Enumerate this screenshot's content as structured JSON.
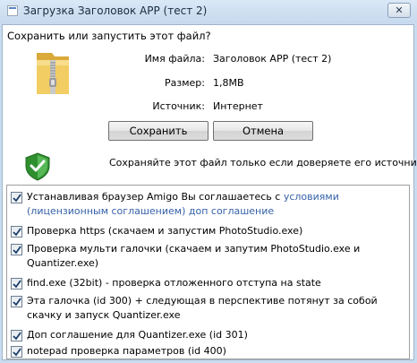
{
  "window": {
    "title": "Загрузка Заголовок APP (тест 2)",
    "close_glyph": "✕"
  },
  "dialog": {
    "question": "Сохранить или запустить этот файл?",
    "file_name_label": "Имя файла:",
    "file_name_value": "Заголовок APP (тест 2)",
    "size_label": "Размер:",
    "size_value": "1,8MB",
    "source_label": "Источник:",
    "source_value": "Интернет",
    "save_label": "Сохранить",
    "cancel_label": "Отмена",
    "warning": "Сохраняйте этот файл только если доверяете его источнику"
  },
  "checklist": {
    "items": [
      {
        "checked": true,
        "text_before": "Устанавливая браузер Amigo Вы соглашаетесь с ",
        "link1": "условиями\n(лицензионным соглашением)",
        "link2": "доп соглашение"
      },
      {
        "checked": true,
        "text": "Проверка https (скачаем и запустим PhotoStudio.exe)"
      },
      {
        "checked": true,
        "text": "Проверка мульти галочки (скачаем и запутим PhotoStudio.exe и\nQuantizer.exe)"
      },
      {
        "checked": true,
        "text": "find.exe (32bit) - проверка отложенного отступа на state"
      },
      {
        "checked": true,
        "text": "Эта галочка (id 300) + следующая в перспективе потянут за собой\nскачку и запуск Quantizer.exe"
      },
      {
        "checked": true,
        "text": "Доп соглашение для Quantizer.exe (id 301)"
      },
      {
        "checked": true,
        "text": "notepad проверка параметров (id 400)"
      }
    ]
  },
  "icons": {
    "app": "window-app-icon",
    "folder": "zip-folder-icon",
    "shield": "security-shield-icon",
    "check": "checkmark-icon"
  },
  "colors": {
    "link": "#3561a8",
    "frame": "#c9dcef",
    "shield": "#3aa53a"
  }
}
